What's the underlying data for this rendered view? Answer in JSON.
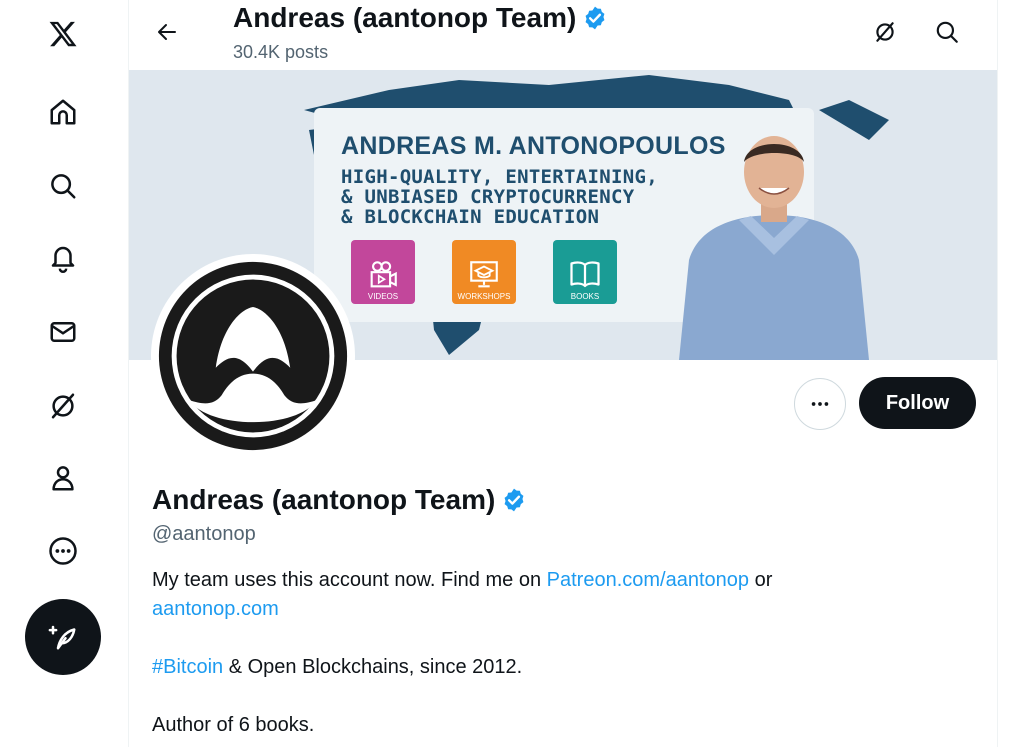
{
  "header": {
    "title": "Andreas (aantonop Team)",
    "posts_count": "30.4K posts"
  },
  "nav": {
    "items": [
      "x-logo",
      "home",
      "explore",
      "notifications",
      "messages",
      "grok",
      "profile",
      "more"
    ],
    "post_button_icon": "compose-icon"
  },
  "banner": {
    "name": "ANDREAS M. ANTONOPOULOS",
    "tagline": [
      "HIGH-QUALITY, ENTERTAINING,",
      "& UNBIASED CRYPTOCURRENCY",
      "& BLOCKCHAIN EDUCATION"
    ],
    "tiles": [
      {
        "label": "VIDEOS",
        "color": "#c2479b"
      },
      {
        "label": "WORKSHOPS",
        "color": "#f08a24"
      },
      {
        "label": "BOOKS",
        "color": "#1a9c95"
      }
    ]
  },
  "profile": {
    "name": "Andreas (aantonop Team)",
    "handle": "@aantonop",
    "follow_label": "Follow",
    "bio": {
      "line1_prefix": "My team uses this account now. Find me on ",
      "line1_link": "Patreon.com/aantonop",
      "line1_suffix": " or",
      "line2_link": "aantonop.com",
      "line3_hashtag": "#Bitcoin",
      "line3_text": " & Open Blockchains, since 2012.",
      "line4": "Author of 6 books."
    }
  },
  "colors": {
    "accent": "#1d9bf0",
    "text": "#0f1419",
    "muted": "#536471",
    "verified": "#1d9bf0"
  }
}
